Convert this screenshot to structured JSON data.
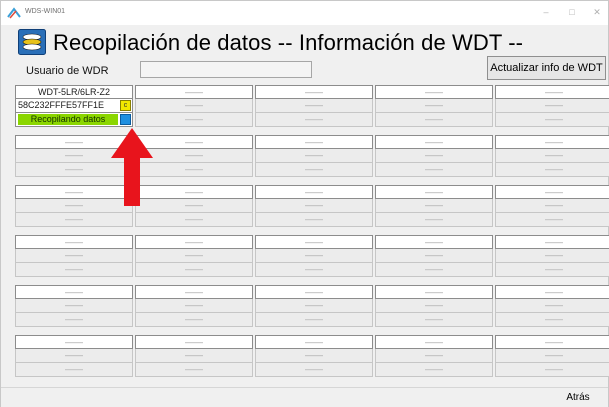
{
  "window": {
    "title": "WDS-WIN01",
    "min_glyph": "–",
    "max_glyph": "□",
    "close_glyph": "✕"
  },
  "header": {
    "title": "Recopilación de datos -- Información de WDT --"
  },
  "user_row": {
    "label": "Usuario de WDR",
    "value": "",
    "update_button": "Actualizar info de WDT"
  },
  "grid": {
    "first_cell": {
      "name": "WDT-5LR/6LR-Z2",
      "id": "58C232FFFE57FF1E",
      "badge": "c",
      "status": "Recopilando datos"
    },
    "empty_name": "——",
    "empty_id": "——",
    "empty_status": "——",
    "columns": 5,
    "rows": 6
  },
  "colors": {
    "status_green": "#8bd600",
    "badge_yellow": "#f2e600",
    "badge_blue": "#1e8fe0",
    "arrow_red": "#e8141c"
  },
  "footer": {
    "back_button": "Atrás"
  }
}
